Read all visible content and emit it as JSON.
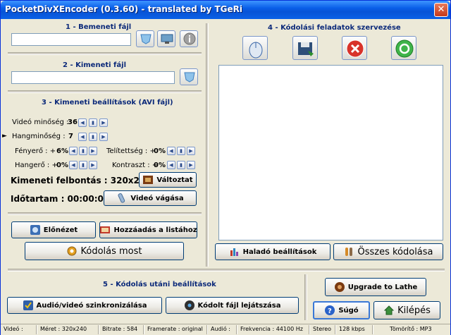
{
  "window": {
    "title": "PocketDivXEncoder (0.3.60) - translated by TGeRi"
  },
  "input_section": {
    "title": "1 - Bemeneti fájl",
    "path_value": ""
  },
  "output_section": {
    "title": "2 - Kimeneti fájl",
    "path_value": ""
  },
  "settings": {
    "title": "3 - Kimeneti beállítások (AVI fájl)",
    "video_quality": {
      "label": "Videó minőség :",
      "value": "36"
    },
    "audio_quality": {
      "label": "Hangminőség :",
      "value": "7"
    },
    "brightness": {
      "label": "Fényerő : +",
      "value": "6%"
    },
    "saturation": {
      "label": "Telítettség : +",
      "value": "0%"
    },
    "volume": {
      "label": "Hangerő : +",
      "value": "0%"
    },
    "contrast": {
      "label": "Kontraszt : +",
      "value": "0%"
    },
    "resolution": {
      "label": "Kimeneti felbontás : 320x240"
    },
    "change_button": "Változtat",
    "duration": {
      "label": "Időtartam : 00:00:00"
    },
    "cut_button": "Videó vágása"
  },
  "actions": {
    "preview": "Előnézet",
    "add_to_list": "Hozzáadás a listához",
    "encode_now": "Kódolás most"
  },
  "queue": {
    "title": "4 - Kódolási feladatok szervezése",
    "advanced": "Haladó beállítások",
    "encode_all": "Összes kódolása"
  },
  "post": {
    "title": "5 - Kódolás utáni beállítások",
    "av_sync": "Audió/videó szinkronizálása",
    "play_encoded": "Kódolt fájl lejátszása"
  },
  "side": {
    "upgrade": "Upgrade to Lathe",
    "help": "Súgó",
    "exit": "Kilépés"
  },
  "status": {
    "video": "Videó :",
    "size": "Méret : 320x240",
    "bitrate": "Bitrate : 584",
    "framerate": "Framerate : original",
    "audio": "Audió :",
    "frequency": "Frekvencia : 44100 Hz",
    "stereo": "Stereo",
    "kbps": "128 kbps",
    "codec": "Tömörítő : MP3"
  },
  "colors": {
    "title_bar": "#0a5fe8",
    "section_title": "#0c2a7a",
    "window_bg": "#ece9d8",
    "close": "#c5391a"
  },
  "icons": {
    "glyphs": {
      "spin_left": "◀",
      "spin_mid": "▮",
      "spin_right": "▶",
      "close": "✕",
      "left_marker": "►"
    }
  }
}
